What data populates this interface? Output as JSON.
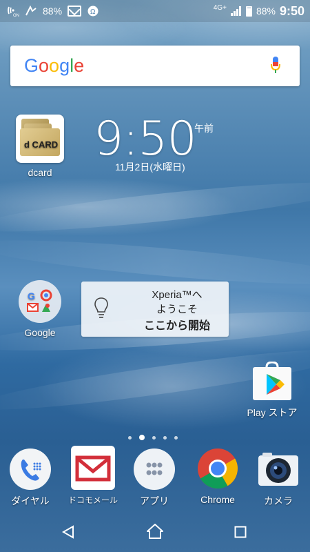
{
  "status_bar": {
    "left_battery_percent": "88%",
    "right_network": "4G+",
    "right_battery_percent": "88%",
    "time": "9:50",
    "battery_level": 0.88
  },
  "search": {
    "logo_letters": [
      "G",
      "o",
      "o",
      "g",
      "l",
      "e"
    ],
    "logo_colors": [
      "#4285F4",
      "#EA4335",
      "#FBBC05",
      "#4285F4",
      "#34A853",
      "#EA4335"
    ]
  },
  "dcard": {
    "label": "dcard",
    "card_text_small": "d CARD",
    "card_text_big": "d CARD"
  },
  "clock": {
    "time": "9:50",
    "ampm": "午前",
    "date": "11月2日(水曜日)"
  },
  "google_folder": {
    "label": "Google"
  },
  "xperia_card": {
    "line1": "Xperia™へ",
    "line2": "ようこそ",
    "line3": "ここから開始"
  },
  "playstore": {
    "label": "Play ストア"
  },
  "page_dots": {
    "count": 5,
    "active_index": 1
  },
  "dock": {
    "items": [
      {
        "label": "ダイヤル",
        "icon": "phone-icon"
      },
      {
        "label": "ドコモメール",
        "icon": "mail-icon"
      },
      {
        "label": "アプリ",
        "icon": "app-drawer-icon"
      },
      {
        "label": "Chrome",
        "icon": "chrome-icon"
      },
      {
        "label": "カメラ",
        "icon": "camera-icon"
      }
    ]
  },
  "colors": {
    "accent_blue": "#4285F4",
    "mail_red": "#D32F3A"
  }
}
